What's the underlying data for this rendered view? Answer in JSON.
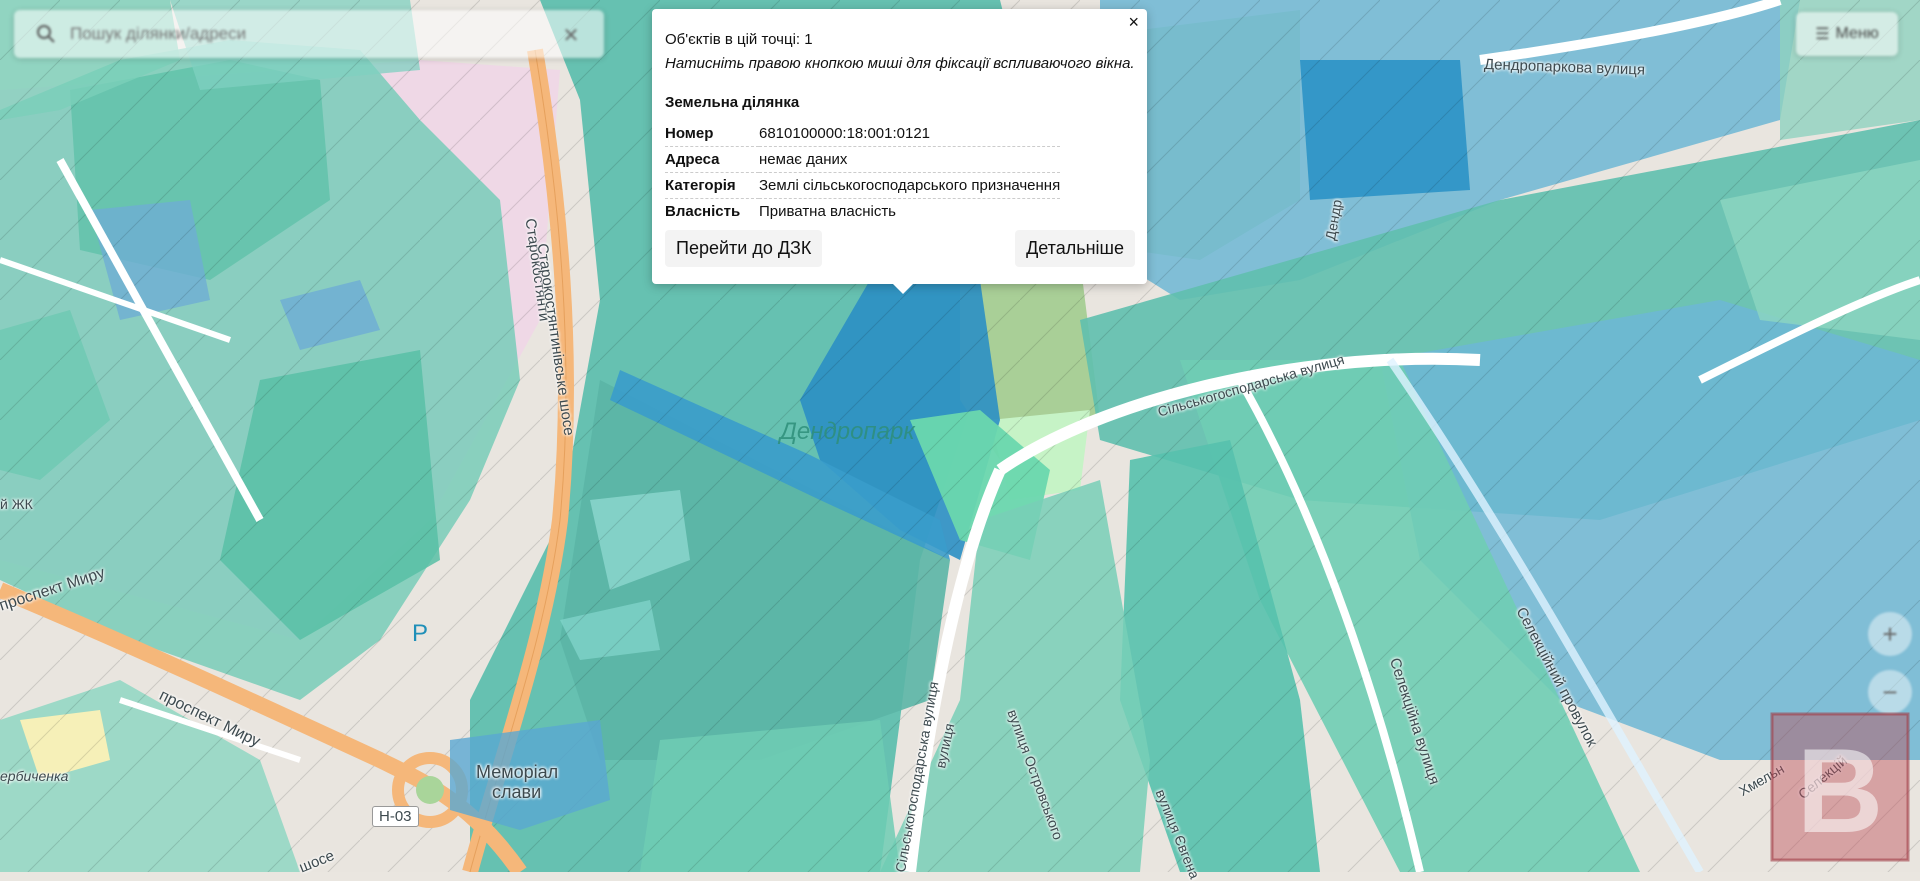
{
  "search": {
    "placeholder": "Пошук ділянки/адреси",
    "clear_icon": "close-icon",
    "icon": "search-icon"
  },
  "menu": {
    "label": "Меню",
    "icon": "menu-icon"
  },
  "zoom": {
    "in": "+",
    "out": "−"
  },
  "popup": {
    "count": "Об'єктів в цій точці: 1",
    "hint": "Натисніть правою кнопкою миші для фіксації вспливаючого вікна.",
    "heading": "Земельна ділянка",
    "close": "×",
    "rows": [
      {
        "key": "Номер",
        "value": "6810100000:18:001:0121"
      },
      {
        "key": "Адреса",
        "value": "немає даних"
      },
      {
        "key": "Категорія",
        "value": "Землі сільськогосподарського призначення"
      },
      {
        "key": "Власність",
        "value": "Приватна власність"
      }
    ],
    "btn_dzk": "Перейти до ДЗК",
    "btn_details": "Детальніше"
  },
  "map": {
    "labels": {
      "dendropark": "Дендропарк",
      "dendroparkova": "Дендропаркова вулиця",
      "silskogo_1": "Сільськогосподарська вулиця",
      "silskogo_2": "Сільськогосподарська вулиця",
      "starokost_1": "Старокостянти",
      "starokost_2": "Старокостянтинівське шосе",
      "myru_1": "проспект Миру",
      "myru_2": "проспект Миру",
      "memorial": "Меморіал",
      "slavy": "слави",
      "h03": "Н-03",
      "selektsiina": "Селекційна вулиця",
      "selektsiinyi": "Селекційний провулок",
      "ostrovskogo": "вулиця Островського",
      "yevgena": "вулиця Євгена",
      "ulytsia": "вулиця",
      "shose": "шосе",
      "zhk": "й ЖК",
      "hmeln": "Хмельн",
      "selekts": "Селекцій",
      "derby": "ербиченка",
      "dendro_short": "Дендр",
      "parking": "P"
    },
    "colors": {
      "base": "#eae6e0",
      "parcel_teal": "#57c3ad",
      "parcel_blue": "#5aa8d2",
      "selected": "#2b8fc4",
      "park": "#a9d59a",
      "road": "#f5b77a"
    }
  },
  "logo": {
    "letter": "B"
  }
}
